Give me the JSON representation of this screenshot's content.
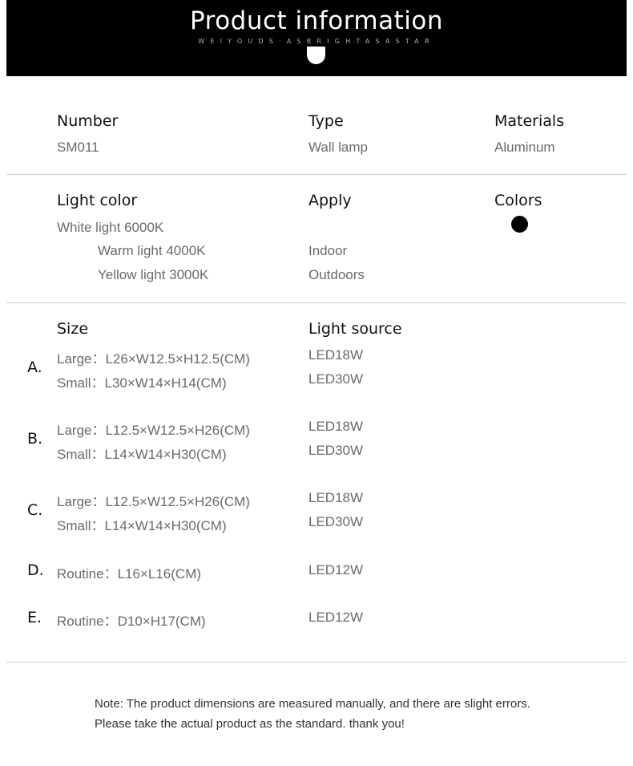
{
  "header": {
    "title": "Product information",
    "subtitle": "WEIYOUDS·ASBRIGHTASASTAR"
  },
  "basic": {
    "number_label": "Number",
    "number_value": "SM011",
    "type_label": "Type",
    "type_value": "Wall lamp",
    "materials_label": "Materials",
    "materials_value": "Aluminum"
  },
  "light": {
    "light_color_label": "Light color",
    "light_colors": [
      "White light 6000K",
      "Warm light 4000K",
      "Yellow light 3000K"
    ],
    "apply_label": "Apply",
    "apply_values": [
      "Indoor",
      "Outdoors"
    ],
    "colors_label": "Colors",
    "swatch_color": "#000000"
  },
  "sizes": {
    "size_label": "Size",
    "source_label": "Light source",
    "models": [
      {
        "letter": "A.",
        "rows": [
          {
            "size": "Large：L26×W12.5×H12.5(CM)",
            "source": "LED18W"
          },
          {
            "size": "Small：L30×W14×H14(CM)",
            "source": "LED30W"
          }
        ]
      },
      {
        "letter": "B.",
        "rows": [
          {
            "size": "Large：L12.5×W12.5×H26(CM)",
            "source": "LED18W"
          },
          {
            "size": "Small：L14×W14×H30(CM)",
            "source": "LED30W"
          }
        ]
      },
      {
        "letter": "C.",
        "rows": [
          {
            "size": "Large：L12.5×W12.5×H26(CM)",
            "source": "LED18W"
          },
          {
            "size": "Small：L14×W14×H30(CM)",
            "source": "LED30W"
          }
        ]
      },
      {
        "letter": "D.",
        "rows": [
          {
            "size": "Routine：L16×L16(CM)",
            "source": "LED12W"
          }
        ]
      },
      {
        "letter": "E.",
        "rows": [
          {
            "size": "Routine：D10×H17(CM)",
            "source": "LED12W"
          }
        ]
      }
    ]
  },
  "note": {
    "line1": "Note:  The product dimensions are measured manually, and there are slight errors.",
    "line2": "Please take the actual product as the standard. thank you!"
  }
}
